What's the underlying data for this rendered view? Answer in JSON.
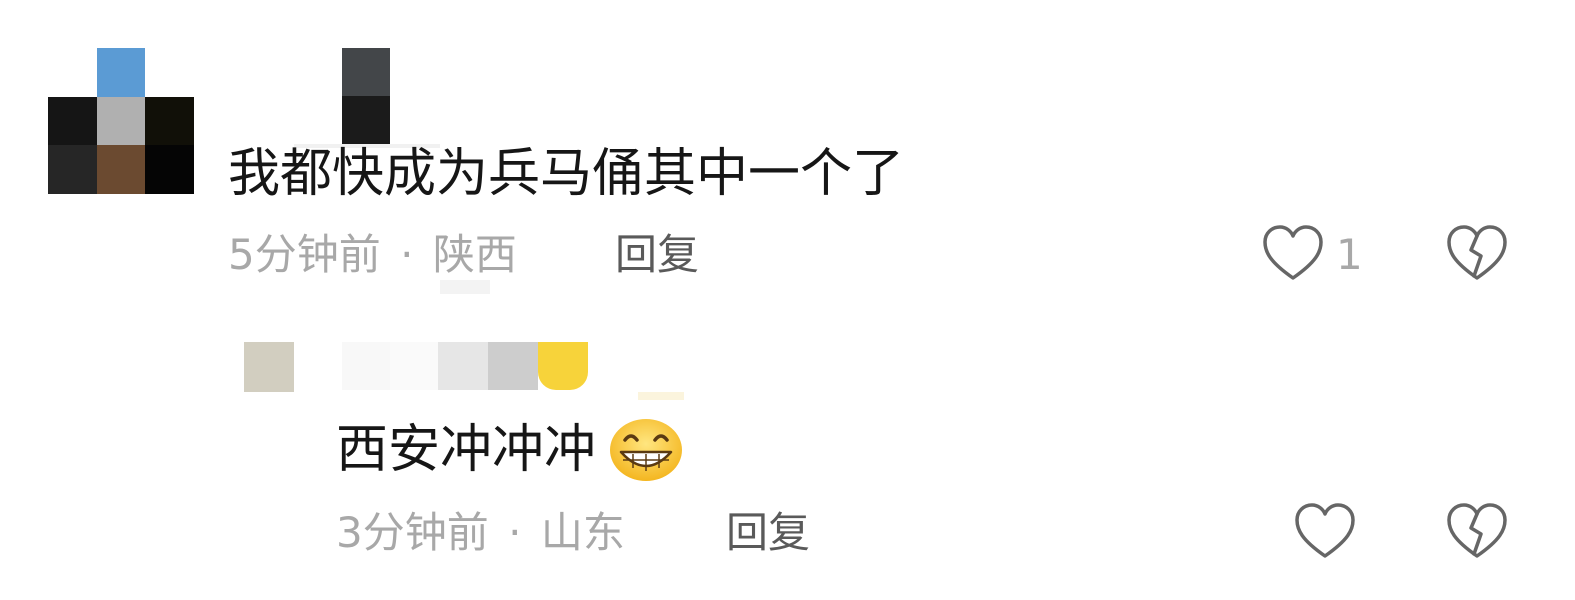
{
  "comments": [
    {
      "text": "我都快成为兵马俑其中一个了",
      "time": "5分钟前",
      "separator": "·",
      "location": "陕西",
      "reply_label": "回复",
      "like_count": "1"
    }
  ],
  "replies": [
    {
      "text": "西安冲冲冲",
      "emoji": "grinning-face-emoji",
      "time": "3分钟前",
      "separator": "·",
      "location": "山东",
      "reply_label": "回复",
      "like_count": ""
    }
  ],
  "icons": {
    "like": "heart-outline-icon",
    "dislike": "broken-heart-icon"
  },
  "colors": {
    "text": "#161616",
    "meta": "#a8a8a8",
    "reply": "#5a5a5a",
    "icon": "#666666"
  }
}
